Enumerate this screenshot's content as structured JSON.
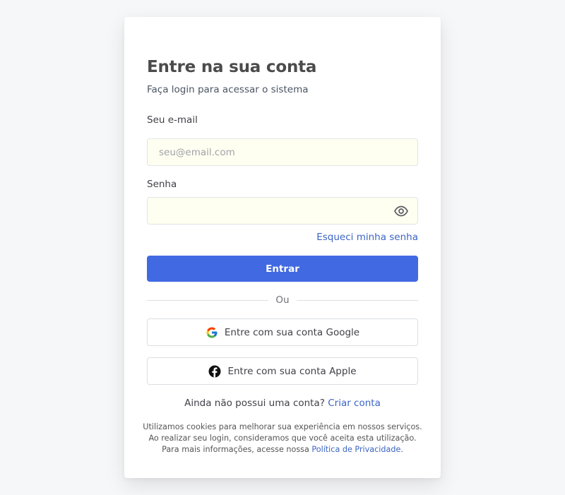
{
  "login": {
    "title": "Entre na sua conta",
    "subtitle": "Faça login para acessar o sistema",
    "email_label": "Seu e-mail",
    "email_placeholder": "seu@email.com",
    "email_value": "",
    "password_label": "Senha",
    "password_value": "",
    "forgot_link": "Esqueci minha senha",
    "submit_label": "Entrar",
    "divider_text": "Ou",
    "google_label": "Entre com sua conta Google",
    "apple_label": "Entre com sua conta Apple",
    "signup_prompt": "Ainda não possui uma conta?",
    "signup_link": "Criar conta",
    "cookies_line1": "Utilizamos cookies para melhorar sua experiência em nossos serviços.",
    "cookies_line2": "Ao realizar seu login, consideramos que você aceita esta utilização.",
    "cookies_line3_prefix": "Para mais informações, acesse nossa",
    "privacy_link": "Política de Privacidade",
    "cookies_line3_suffix": "."
  },
  "colors": {
    "primary": "#4169e1",
    "link": "#3b64c4",
    "input_background": "#fefff0",
    "page_background": "#f6f7f9"
  },
  "icons": {
    "password_toggle": "eye-icon",
    "google": "google-icon",
    "apple": "facebook-icon"
  }
}
